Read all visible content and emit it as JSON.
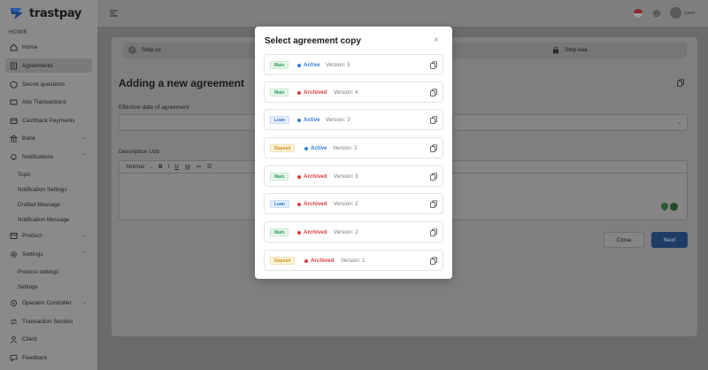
{
  "app": {
    "logo_text": "trastpay"
  },
  "sidebar": {
    "home_label": "HOME",
    "items": [
      {
        "label": "Home",
        "icon": "home-icon"
      },
      {
        "label": "Agreements",
        "icon": "document-icon",
        "active": true
      },
      {
        "label": "Secret questions",
        "icon": "shield-icon"
      },
      {
        "label": "Abs Transactions",
        "icon": "transactions-icon"
      },
      {
        "label": "Cashback Payments",
        "icon": "wallet-icon"
      },
      {
        "label": "Bank",
        "icon": "bank-icon",
        "expandable": true
      },
      {
        "label": "Notifications",
        "icon": "bell-icon",
        "expandable": true,
        "expanded": true
      },
      {
        "label": "Product",
        "icon": "box-icon",
        "expandable": true
      },
      {
        "label": "Settings",
        "icon": "gear-icon",
        "expandable": true,
        "expanded": true
      },
      {
        "label": "Operator Controller",
        "icon": "operator-icon",
        "expandable": true
      },
      {
        "label": "Transaction Section",
        "icon": "transaction-section-icon"
      },
      {
        "label": "Client",
        "icon": "user-icon"
      },
      {
        "label": "Feedback",
        "icon": "feedback-icon"
      }
    ],
    "notifications_sub": [
      "Topic",
      "Notification Settings",
      "Drafted Message",
      "Notification Message"
    ],
    "settings_sub": [
      "Process settings",
      "Settings"
    ]
  },
  "topbar": {
    "user_label": "USER"
  },
  "stepper": {
    "step1_label": "Step uz",
    "step3_label": "Step kaa"
  },
  "form": {
    "title": "Adding a new agreement",
    "effective_date_label": "Effective date of agreement",
    "description_label": "Description Uzb",
    "toolbar_style": "Normal",
    "toolbar_buttons": [
      "B",
      "I",
      "U",
      "⛓",
      "≔",
      "☰"
    ]
  },
  "actions": {
    "close_label": "Close",
    "next_label": "Next"
  },
  "modal": {
    "title": "Select agreement copy",
    "close_glyph": "×",
    "rows": [
      {
        "type": "Main",
        "kind": "main",
        "status": "Active",
        "version": "Version: 5"
      },
      {
        "type": "Main",
        "kind": "main",
        "status": "Archived",
        "version": "Version: 4"
      },
      {
        "type": "Loan",
        "kind": "loan",
        "status": "Active",
        "version": "Version: 3"
      },
      {
        "type": "Deposit",
        "kind": "deposit",
        "status": "Active",
        "version": "Version: 2"
      },
      {
        "type": "Main",
        "kind": "main",
        "status": "Archived",
        "version": "Version: 3"
      },
      {
        "type": "Loan",
        "kind": "loan",
        "status": "Archived",
        "version": "Version: 2"
      },
      {
        "type": "Main",
        "kind": "main",
        "status": "Archived",
        "version": "Version: 2"
      },
      {
        "type": "Deposit",
        "kind": "deposit",
        "status": "Archived",
        "version": "Version: 1"
      }
    ]
  },
  "colors": {
    "active": "#2f7fd6",
    "archived": "#d93b3b",
    "primary_button": "#1e3d66"
  }
}
